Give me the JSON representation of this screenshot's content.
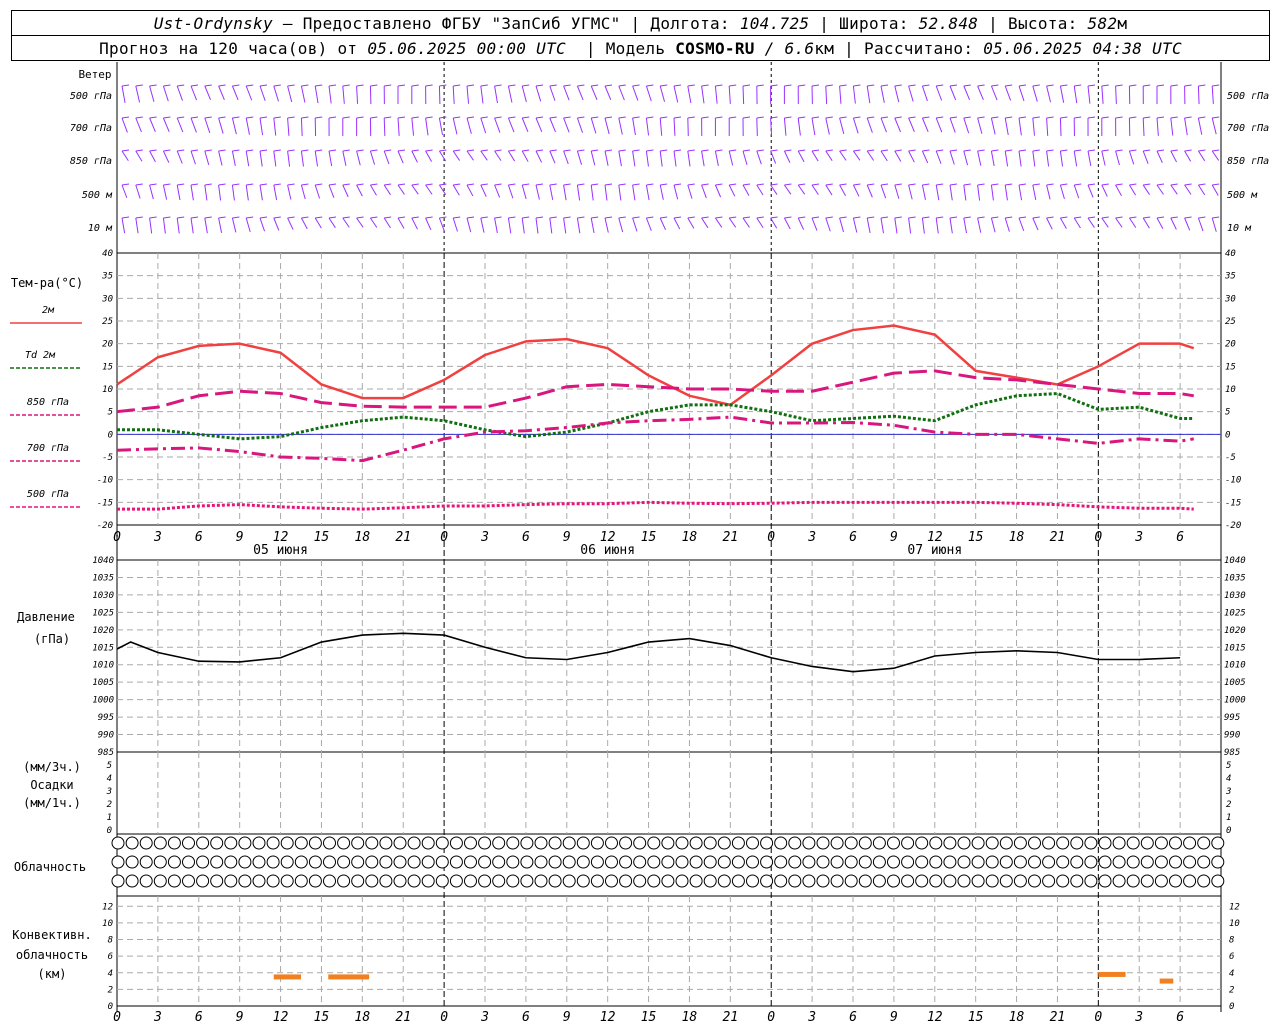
{
  "header": {
    "station": "Ust-Ordynsky",
    "provided_by": "– Предоставлено ФГБУ \"ЗапСиб УГМС\"",
    "lon_label": "Долгота:",
    "lon_value": "104.725",
    "lat_label": "Широта:",
    "lat_value": "52.848",
    "alt_label": "Высота:",
    "alt_value": "582",
    "alt_unit": "м",
    "forecast_label": "Прогноз на 120 часа(ов) от",
    "forecast_start": "05.06.2025 00:00 UTC",
    "model_label": "Модель",
    "model_name": "COSMO-RU",
    "model_res": "/ 6.6",
    "model_res_unit": "км",
    "computed_label": "Рассчитано:",
    "computed_value": "05.06.2025 04:38 UTC"
  },
  "panels": {
    "wind": {
      "title": "Ветер",
      "levels": [
        "500 гПа",
        "700 гПа",
        "850 гПа",
        "500 м",
        "10 м"
      ]
    },
    "temperature": {
      "title": "Тем-ра(°C)",
      "legend": [
        {
          "label": "2м",
          "color": "#f04040",
          "style": "solid"
        },
        {
          "label": "Td  2м",
          "color": "#107010",
          "style": "dotted"
        },
        {
          "label": "850 гПа",
          "color": "#d8167e",
          "style": "dashed"
        },
        {
          "label": "700 гПа",
          "color": "#d8167e",
          "style": "dashdot"
        },
        {
          "label": "500 гПа",
          "color": "#e8147c",
          "style": "dotted"
        }
      ]
    },
    "pressure": {
      "title": "Давление",
      "unit": "(гПа)"
    },
    "precip": {
      "unit_top": "(мм/3ч.)",
      "title": "Осадки",
      "unit_bottom": "(мм/1ч.)"
    },
    "cloud": {
      "title": "Облачность"
    },
    "convective": {
      "title_1": "Конвективн.",
      "title_2": "облачность",
      "unit": "(км)"
    }
  },
  "date_labels": [
    "05 июня",
    "06 июня",
    "07 июня"
  ],
  "chart_data": [
    {
      "type": "line",
      "name": "temperature",
      "x_hours": [
        0,
        3,
        6,
        9,
        12,
        15,
        18,
        21,
        24,
        27,
        30,
        33,
        36,
        39,
        42,
        45,
        48,
        51,
        54,
        57,
        60,
        63,
        66,
        69,
        72,
        75,
        78,
        79
      ],
      "x_tick_labels": [
        "0",
        "3",
        "6",
        "9",
        "12",
        "15",
        "18",
        "21",
        "0",
        "3",
        "6",
        "9",
        "12",
        "15",
        "18",
        "21",
        "0",
        "3",
        "6",
        "9",
        "12",
        "15",
        "18",
        "21",
        "0",
        "3",
        "6"
      ],
      "ylim": [
        -20,
        40
      ],
      "y_ticks": [
        -20,
        -15,
        -10,
        -5,
        0,
        5,
        10,
        15,
        20,
        25,
        30,
        35,
        40
      ],
      "series": [
        {
          "name": "2м",
          "values": [
            11,
            17,
            19.5,
            20,
            18,
            11,
            8,
            8,
            12,
            17.5,
            20.5,
            21,
            19,
            13,
            8.5,
            6.5,
            13,
            20,
            23,
            24,
            22,
            14,
            12.5,
            11,
            15,
            20,
            20,
            19
          ]
        },
        {
          "name": "Td  2м",
          "values": [
            1,
            1,
            0,
            -1,
            -0.5,
            1.5,
            3,
            3.8,
            3,
            1,
            -0.5,
            0.5,
            2.5,
            5,
            6.5,
            6.5,
            5,
            3,
            3.5,
            4,
            3,
            6.5,
            8.5,
            9,
            5.5,
            6,
            3.5,
            3.5
          ]
        },
        {
          "name": "850 гПа",
          "values": [
            5,
            6,
            8.5,
            9.5,
            9,
            7,
            6.2,
            6,
            6,
            6,
            8,
            10.5,
            11,
            10.5,
            10,
            10,
            9.5,
            9.5,
            11.5,
            13.5,
            14,
            12.5,
            12,
            11,
            10,
            9,
            9,
            8.5
          ]
        },
        {
          "name": "700 гПа",
          "values": [
            -3.5,
            -3.2,
            -3,
            -3.8,
            -5,
            -5.3,
            -5.8,
            -3.5,
            -1,
            0.5,
            0.8,
            1.5,
            2.5,
            3,
            3.3,
            3.8,
            2.5,
            2.5,
            2.6,
            2,
            0.5,
            0,
            0,
            -1,
            -2,
            -1,
            -1.5,
            -1
          ]
        },
        {
          "name": "500 гПа",
          "values": [
            -16.5,
            -16.5,
            -15.8,
            -15.5,
            -16,
            -16.3,
            -16.5,
            -16.2,
            -15.8,
            -15.8,
            -15.5,
            -15.3,
            -15.3,
            -15,
            -15.2,
            -15.3,
            -15.2,
            -15,
            -15,
            -15,
            -15,
            -15,
            -15.2,
            -15.5,
            -16,
            -16.3,
            -16.3,
            -16.5
          ]
        }
      ]
    },
    {
      "type": "line",
      "name": "pressure",
      "x_hours": [
        0,
        1,
        3,
        6,
        9,
        12,
        15,
        18,
        21,
        24,
        27,
        30,
        33,
        36,
        39,
        42,
        45,
        48,
        51,
        54,
        57,
        60,
        63,
        66,
        69,
        72,
        75,
        78,
        79
      ],
      "ylim": [
        985,
        1040
      ],
      "y_ticks": [
        985,
        990,
        995,
        1000,
        1005,
        1010,
        1015,
        1020,
        1025,
        1030,
        1035,
        1040
      ],
      "series": [
        {
          "name": "Давление",
          "values": [
            1014.5,
            1016.5,
            1013.5,
            1011,
            1010.8,
            1012,
            1016.5,
            1018.5,
            1019,
            1018.5,
            1015,
            1012,
            1011.5,
            1013.5,
            1016.5,
            1017.5,
            1015.5,
            1012,
            1009.5,
            1008,
            1009,
            1012.5,
            1013.5,
            1014,
            1013.5,
            1011.5,
            1011.5,
            1012
          ]
        }
      ]
    },
    {
      "type": "bar",
      "name": "precipitation",
      "ylim": [
        0,
        5
      ],
      "y_ticks": [
        0,
        1,
        2,
        3,
        4,
        5
      ],
      "series": []
    },
    {
      "type": "bar",
      "name": "convective_cloud",
      "ylim": [
        0,
        13
      ],
      "y_ticks": [
        0,
        2,
        4,
        6,
        8,
        10,
        12
      ],
      "y_ticks_right": [
        0,
        2,
        4,
        6,
        8,
        10,
        12
      ],
      "segments": [
        {
          "start_hour": 11.5,
          "end_hour": 13.5,
          "top_km": 3.5
        },
        {
          "start_hour": 15.5,
          "end_hour": 18.5,
          "top_km": 3.5
        },
        {
          "start_hour": 72,
          "end_hour": 74,
          "top_km": 3.8
        },
        {
          "start_hour": 76.5,
          "end_hour": 77.5,
          "top_km": 3
        }
      ]
    }
  ],
  "colors": {
    "wind": "#9b30ff",
    "t2m": "#f04040",
    "td2m": "#107010",
    "t850": "#d8167e",
    "t700": "#d8167e",
    "t500": "#e8147c",
    "pressure": "#000000",
    "convective": "#f08020",
    "zero_line": "#3030d0"
  }
}
